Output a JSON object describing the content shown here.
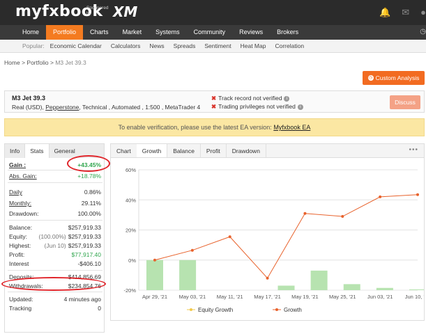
{
  "brand": {
    "logo_prefix": "my",
    "logo_fx": "fx",
    "logo_suffix": "book",
    "sponsored": "Sponsored",
    "by": "by",
    "sponsor": "XM"
  },
  "top_icons": [
    "bell-icon",
    "mail-icon",
    "chat-icon"
  ],
  "main_nav": [
    "Home",
    "Portfolio",
    "Charts",
    "Market",
    "Systems",
    "Community",
    "Reviews",
    "Brokers"
  ],
  "main_nav_active": "Portfolio",
  "sub_nav": {
    "label": "Popular:",
    "items": [
      "Economic Calendar",
      "Calculators",
      "News",
      "Spreads",
      "Sentiment",
      "Heat Map",
      "Correlation"
    ]
  },
  "breadcrumb": {
    "home": "Home",
    "sep": ">",
    "portfolio": "Portfolio",
    "current": "M3 Jet 39.3"
  },
  "custom_analysis_label": "Custom Analysis",
  "system": {
    "name": "M3 Jet 39.3",
    "desc_prefix": "Real (USD),",
    "broker": "Pepperstone",
    "desc_suffix": ", Technical , Automated , 1:500 , MetaTrader 4",
    "verif1": "Track record not verified",
    "verif2": "Trading privileges not verified",
    "discuss_label": "Discuss"
  },
  "notice": {
    "text": "To enable verification, please use the latest EA version:",
    "link": "Myfxbook EA"
  },
  "left_tabs": [
    "Info",
    "Stats",
    "General"
  ],
  "left_tab_active": "Stats",
  "stats": {
    "gain_label": "Gain :",
    "gain": "+43.45%",
    "abs_gain_label": "Abs. Gain:",
    "abs_gain": "+18.78%",
    "daily_label": "Daily",
    "daily": "0.86%",
    "monthly_label": "Monthly:",
    "monthly": "29.11%",
    "drawdown_label": "Drawdown:",
    "drawdown": "100.00%",
    "balance_label": "Balance:",
    "balance": "$257,919.33",
    "equity_label": "Equity:",
    "equity_pct": "(100.00%)",
    "equity": "$257,919.33",
    "highest_label": "Highest:",
    "highest_date": "(Jun 10)",
    "highest": "$257,919.33",
    "profit_label": "Profit:",
    "profit": "$77,917.40",
    "interest_label": "Interest",
    "interest": "-$406.10",
    "deposits_label": "Deposits:",
    "deposits": "$414,856.69",
    "withdrawals_label": "Withdrawals:",
    "withdrawals": "$234,854.76",
    "updated_label": "Updated:",
    "updated": "4 minutes ago",
    "tracking_label": "Tracking",
    "tracking": "0"
  },
  "chart_tabs": [
    "Chart",
    "Growth",
    "Balance",
    "Profit",
    "Drawdown"
  ],
  "chart_tab_active": "Growth",
  "colors": {
    "accent": "#f47b20",
    "growth_line": "#e8622c",
    "equity_line": "#f2c94c",
    "bars": "#b7e3b0",
    "gain_green": "#2fa54d",
    "annotation": "#e0242a"
  },
  "chart_data": {
    "type": "line",
    "x": [
      "Apr 29, '21",
      "May 03, '21",
      "May 11, '21",
      "May 17, '21",
      "May 19, '21",
      "May 25, '21",
      "Jun 03, '21",
      "Jun 10, '21"
    ],
    "x_tick_labels": [
      "Apr 29, '21",
      "May 03, '21",
      "May 11, '21",
      "May 17, '21",
      "May 19, '21",
      "May 25, '21",
      "Jun 03, '21",
      "Jun 10, '21"
    ],
    "series": [
      {
        "name": "Growth",
        "values": [
          0,
          6.5,
          15.5,
          -12,
          31,
          29,
          42,
          43.45
        ]
      },
      {
        "name": "Equity Growth",
        "values": []
      }
    ],
    "bars": [
      0,
      0,
      -20,
      -20,
      -17,
      -7,
      -16,
      -18.5,
      -19.5
    ],
    "bar_positions": [
      "",
      "May 03, '21",
      "May 11, '21",
      "May 17, '21",
      "May 19, '21",
      "May 25, '21",
      "Jun 03, '21",
      "Jun 10, '21"
    ],
    "y_ticks": [
      "60%",
      "40%",
      "20%",
      "0%",
      "-20%"
    ],
    "ylim": [
      -20,
      60
    ],
    "grid": true,
    "legend_position": "bottom"
  }
}
